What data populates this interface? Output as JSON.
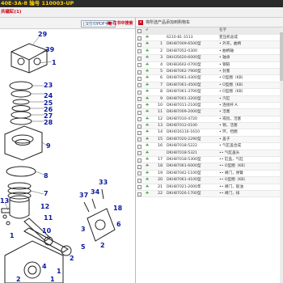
{
  "header": {
    "title": "40E-3A-8 输号 110003-UP",
    "subtitle": "共磁缸(1)"
  },
  "left_toolbar": {
    "pdf_button": "[汉打印PDF手册",
    "find_button": "■ 在书中搜索"
  },
  "diagram": {
    "callouts": [
      "29",
      "39",
      "1",
      "23",
      "24",
      "25",
      "26",
      "27",
      "28",
      "9",
      "8",
      "7",
      "12",
      "13",
      "11",
      "10",
      "1",
      "2",
      "4",
      "5",
      "3",
      "37",
      "34",
      "33",
      "18",
      "6",
      "2",
      "1",
      "1",
      "2"
    ]
  },
  "right_panel": {
    "header": "将所选产品添加到购物车",
    "columns": {
      "no": "",
      "part_no": "",
      "name": "名字"
    },
    "rows": [
      {
        "no": "",
        "part_no": "6210-81-3113",
        "name": "变压机总成"
      },
      {
        "no": "1",
        "part_no": "DKH87009-6500型",
        "name": "• 外壳，曲柄"
      },
      {
        "no": "2",
        "part_no": "DKH87052-0300",
        "name": "• 曲柄轴"
      },
      {
        "no": "3",
        "part_no": "DKH35620-6000型",
        "name": "• 轴承"
      },
      {
        "no": "4",
        "part_no": "DKH83602-0700型",
        "name": "• 钢链"
      },
      {
        "no": "5",
        "part_no": "DKH87062-7900型",
        "name": "• 封塞"
      },
      {
        "no": "6",
        "part_no": "DKH87061-4300型",
        "name": "• O型圈（KB）"
      },
      {
        "no": "7",
        "part_no": "DKH87061-4500型",
        "name": "• O型圈（KB）"
      },
      {
        "no": "8",
        "part_no": "DKH87061-3700型",
        "name": "• O型圈（KB）"
      },
      {
        "no": "9",
        "part_no": "DKH87001-3200型",
        "name": "• 汽缸"
      },
      {
        "no": "10",
        "part_no": "DKH87011-2100型",
        "name": "• 连接杆 A."
      },
      {
        "no": "11",
        "part_no": "DKH87009-2000型",
        "name": "• 活塞"
      },
      {
        "no": "12",
        "part_no": "DKH87010-4720",
        "name": "• 戒指，活塞"
      },
      {
        "no": "13",
        "part_no": "DKH87012-0100",
        "name": "• 销，活塞"
      },
      {
        "no": "14",
        "part_no": "DKH016110-1610",
        "name": "• 环，挡圈"
      },
      {
        "no": "15",
        "part_no": "DKH87020-2290型",
        "name": "• 盖子"
      },
      {
        "no": "16",
        "part_no": "DKH87018-5222",
        "name": "• 气缸盖合成"
      },
      {
        "no": "",
        "part_no": "DKH87018-5321",
        "name": "•• 气缸盖头"
      },
      {
        "no": "17",
        "part_no": "DKH87018-5300型",
        "name": "•• 缸盖，气缸"
      },
      {
        "no": "18",
        "part_no": "DKH87061-6000型",
        "name": "•• O型圈（KB）"
      },
      {
        "no": "19",
        "part_no": "DKH87042-1100型",
        "name": "•• 阀门，弹簧"
      },
      {
        "no": "20",
        "part_no": "DKH87061-4100型",
        "name": "•• O型圈（KB）"
      },
      {
        "no": "21",
        "part_no": "DKH87021-2000年",
        "name": "•• 阀门，吸油"
      },
      {
        "no": "22",
        "part_no": "DKH87026-1700型",
        "name": "•• 阀门，排"
      }
    ]
  },
  "colors": {
    "title_bg": "#2b2b2b",
    "title_text": "#ffd200",
    "accent_red": "#c8001a",
    "callout_blue": "#0a1aa0"
  }
}
